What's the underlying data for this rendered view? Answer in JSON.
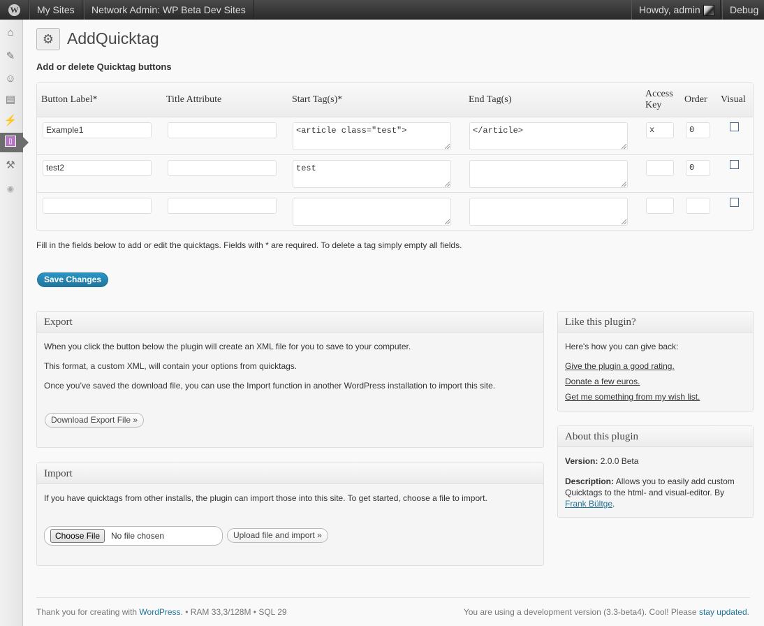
{
  "adminbar": {
    "my_sites": "My Sites",
    "network_admin": "Network Admin: WP Beta Dev Sites",
    "howdy": "Howdy, admin",
    "debug": "Debug"
  },
  "page": {
    "title": "AddQuicktag",
    "section_title": "Add or delete Quicktag buttons"
  },
  "table": {
    "headers": {
      "button_label": "Button Label*",
      "title_attribute": "Title Attribute",
      "start_tags": "Start Tag(s)*",
      "end_tags": "End Tag(s)",
      "access_key_line1": "Access",
      "access_key_line2": "Key",
      "order": "Order",
      "visual": "Visual"
    },
    "rows": [
      {
        "label": "Example1",
        "title": "",
        "start": "<article class=\"test\">",
        "end": "</article>",
        "access": "x",
        "order": "0",
        "visual": false
      },
      {
        "label": "test2",
        "title": "",
        "start": "test",
        "end": "",
        "access": "",
        "order": "0",
        "visual": false
      },
      {
        "label": "",
        "title": "",
        "start": "",
        "end": "",
        "access": "",
        "order": "",
        "visual": false
      }
    ]
  },
  "help_text": "Fill in the fields below to add or edit the quicktags. Fields with * are required. To delete a tag simply empty all fields.",
  "save_button": "Save Changes",
  "export": {
    "title": "Export",
    "p1": "When you click the button below the plugin will create an XML file for you to save to your computer.",
    "p2": "This format, a custom XML, will contain your options from quicktags.",
    "p3": "Once you’ve saved the download file, you can use the Import function in another WordPress installation to import this site.",
    "button": "Download Export File »"
  },
  "import": {
    "title": "Import",
    "p1": "If you have quicktags from other installs, the plugin can import those into this site. To get started, choose a file to import.",
    "choose_file": "Choose File",
    "no_file": "No file chosen",
    "upload_button": "Upload file and import »"
  },
  "like": {
    "title": "Like this plugin?",
    "intro": "Here's how you can give back:",
    "link1": "Give the plugin a good rating.",
    "link2": "Donate a few euros.",
    "link3": "Get me something from my wish list."
  },
  "about": {
    "title": "About this plugin",
    "version_label": "Version:",
    "version_value": "2.0.0 Beta",
    "desc_label": "Description:",
    "desc_line1": "Allows you to easily add custom",
    "desc_line2": "Quicktags to the html- and visual-editor. By",
    "author": "Frank Bültge",
    "period": "."
  },
  "footer": {
    "thanks": "Thank you for creating with",
    "wordpress": "WordPress",
    "stats": ". • RAM 33,3/128M • SQL 29",
    "version_text": "You are using a development version (3.3-beta4). Cool! Please",
    "stay_updated": "stay updated",
    "period": "."
  },
  "icons": {
    "menu": [
      "dashboard-icon",
      "posts-icon",
      "users-icon",
      "appearance-icon",
      "plugins-icon",
      "quicktag-icon",
      "tools-icon",
      "collapse-icon"
    ]
  },
  "colors": {
    "primary_button": "#21759b",
    "link": "#21759b",
    "adminbar": "#333333"
  }
}
